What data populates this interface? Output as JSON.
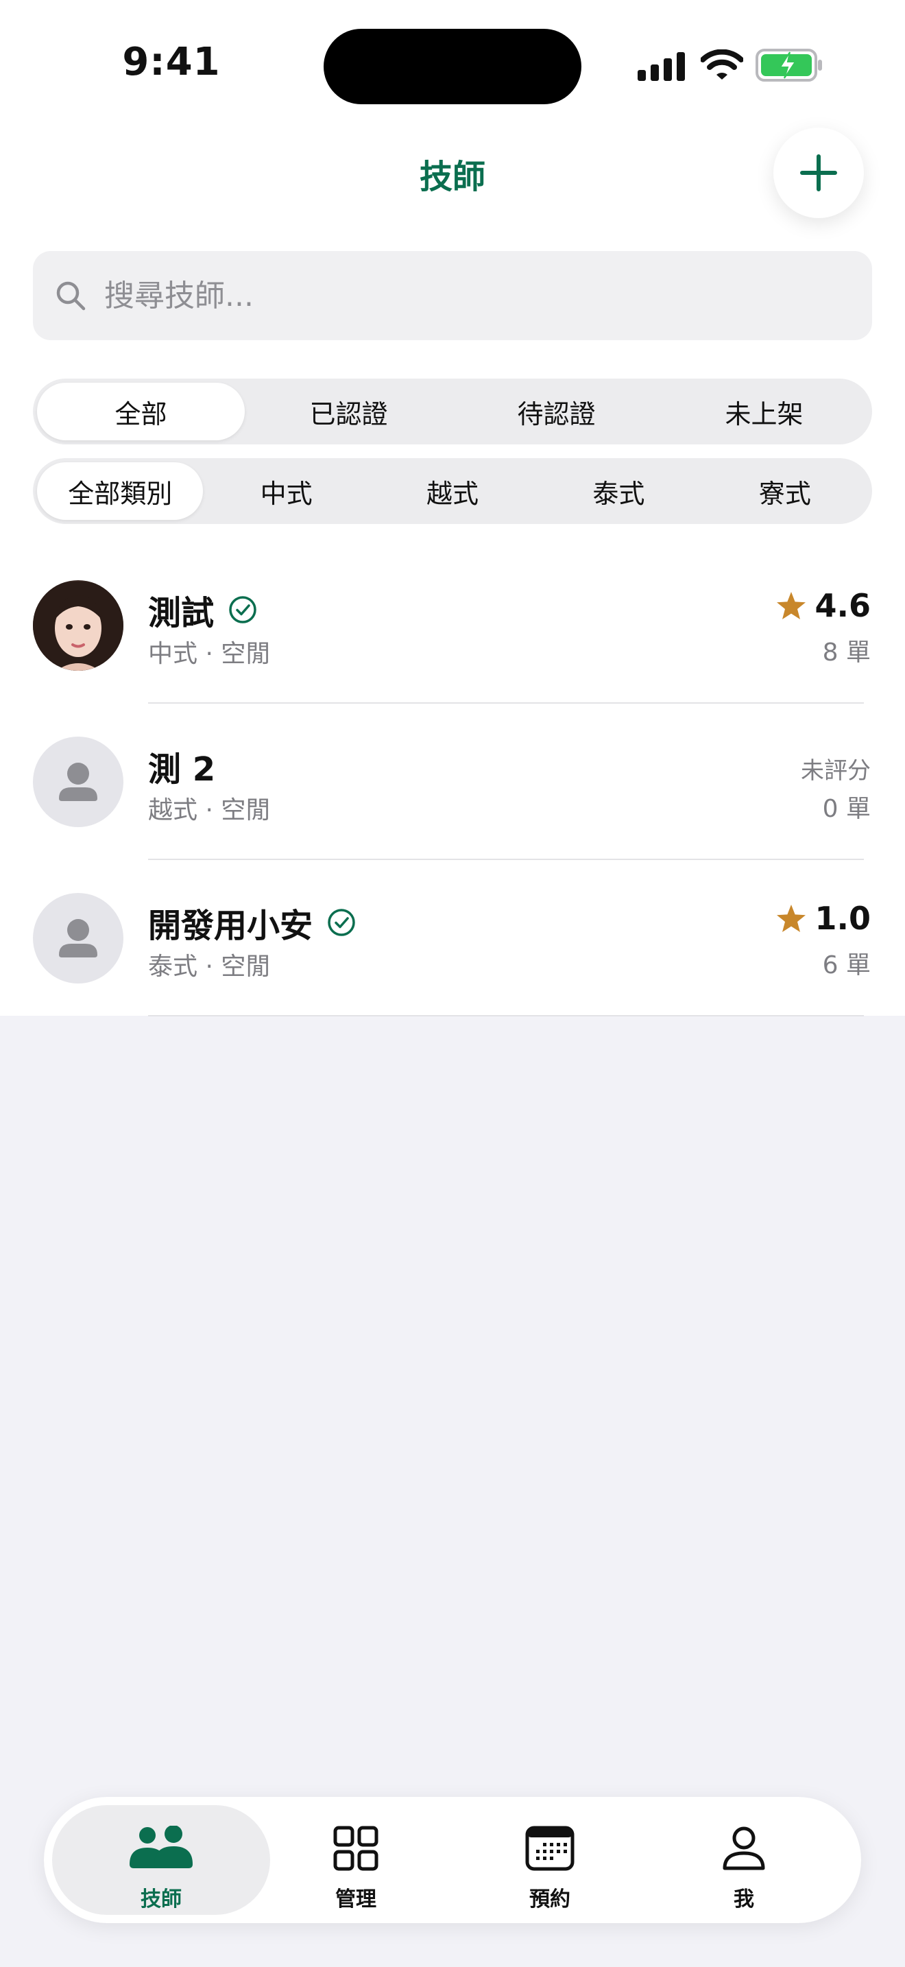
{
  "status_bar": {
    "time": "9:41"
  },
  "header": {
    "title": "技師"
  },
  "search": {
    "placeholder": "搜尋技師..."
  },
  "status_filter": {
    "options": [
      "全部",
      "已認證",
      "待認證",
      "未上架"
    ],
    "selected": "全部"
  },
  "category_filter": {
    "options": [
      "全部類別",
      "中式",
      "越式",
      "泰式",
      "寮式"
    ],
    "selected": "全部類別"
  },
  "technicians": [
    {
      "name": "測試",
      "verified": true,
      "meta": "中式 · 空閒",
      "rating": "4.6",
      "orders": "8 單",
      "avatar": "photo"
    },
    {
      "name": "測 2",
      "verified": false,
      "meta": "越式 · 空閒",
      "rating_text": "未評分",
      "orders": "0 單",
      "avatar": "placeholder"
    },
    {
      "name": "開發用小安",
      "verified": true,
      "meta": "泰式 · 空閒",
      "rating": "1.0",
      "orders": "6 單",
      "avatar": "placeholder"
    }
  ],
  "tab_bar": {
    "items": [
      {
        "label": "技師",
        "icon": "people-icon",
        "active": true
      },
      {
        "label": "管理",
        "icon": "grid-icon",
        "active": false
      },
      {
        "label": "預約",
        "icon": "calendar-icon",
        "active": false
      },
      {
        "label": "我",
        "icon": "person-icon",
        "active": false
      }
    ]
  },
  "colors": {
    "accent": "#0b6e4f",
    "star": "#c8872b",
    "battery": "#34c759"
  }
}
